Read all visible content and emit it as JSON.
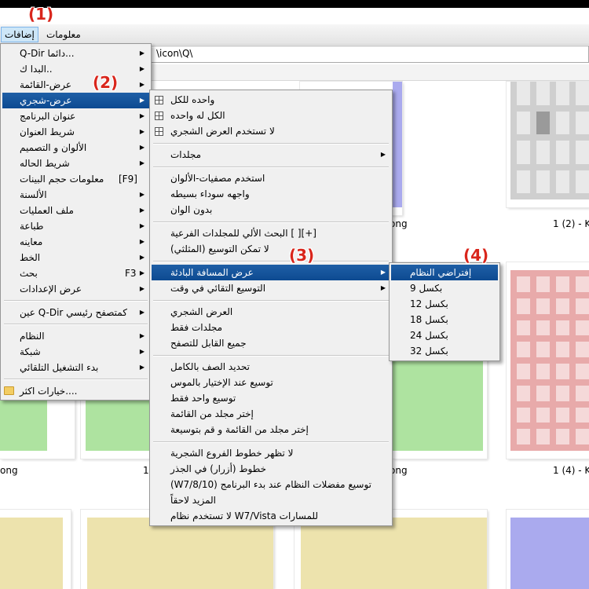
{
  "menubar": {
    "items": [
      "معلومات",
      "إضافات"
    ]
  },
  "address": {
    "path": "\\icon\\Q\\"
  },
  "captions": {
    "c1": "1 (2) - Ko",
    "c2": "ong",
    "c3": "ong",
    "c4": "ong",
    "c5": "1",
    "c6": "1 (4) - Ko"
  },
  "menu_main": {
    "items": [
      {
        "label": "Q-Dir دائما...",
        "sub": "▶"
      },
      {
        "label": "البدا ك..",
        "sub": "▶"
      },
      {
        "label": "عرض-القائمة",
        "sub": "▶"
      },
      {
        "label": "عرض-شجري",
        "sub": "▶"
      },
      {
        "label": "عنوان البرنامج",
        "sub": "▶"
      },
      {
        "label": "شريط العنوان",
        "sub": "▶"
      },
      {
        "label": "الألوان و التصميم",
        "sub": "▶"
      },
      {
        "label": "شريط الحاله",
        "sub": "▶"
      },
      {
        "label": "معلومات حجم البينات",
        "shortcut": "[F9]"
      },
      {
        "label": "الألسنة",
        "sub": "▶"
      },
      {
        "label": "ملف العمليات",
        "sub": "▶"
      },
      {
        "label": "طباعة",
        "sub": "▶"
      },
      {
        "label": "معاينه",
        "sub": "▶"
      },
      {
        "label": "الخط",
        "sub": "▶"
      },
      {
        "label": "بحث",
        "shortcut": "F3",
        "sub": "▶"
      },
      {
        "label": "عرض الإعدادات",
        "sub": "▶"
      },
      {
        "label": "عين Q-Dir كمتصفح رئيسي",
        "sub": "▶"
      },
      {
        "label": "النظام",
        "sub": "▶"
      },
      {
        "label": "شبكة",
        "sub": "▶"
      },
      {
        "label": "بدء التشغيل التلقائي",
        "sub": "▶"
      },
      {
        "label": "خيارات اكثر....",
        "icon": "folder-icon"
      }
    ]
  },
  "menu_tree": {
    "items": [
      {
        "label": "واحده للكل",
        "icon": "grid-icon"
      },
      {
        "label": "الكل له واحده",
        "icon": "grid-icon"
      },
      {
        "label": "لا تستخدم العرض الشجري",
        "icon": "grid-icon"
      },
      {
        "label": "مجلدات",
        "sub": "▶"
      },
      {
        "label": "استخدم مصفيات-الألوان"
      },
      {
        "label": "واجهه سوداء بسيطه"
      },
      {
        "label": "بدون الوان"
      },
      {
        "label": "البحث الألي للمجلدات الفرعية [ ][+]"
      },
      {
        "label": "لا تمكن التوسيع (المثلثي)"
      },
      {
        "label": "عرض المسافة البادئة",
        "sub": "▶"
      },
      {
        "label": "التوسيع التقائي في وقت",
        "sub": "▶"
      },
      {
        "label": "العرض الشجري"
      },
      {
        "label": "مجلدات فقط"
      },
      {
        "label": "جميع القابل للتصفح"
      },
      {
        "label": "تحديد الصف بالكامل"
      },
      {
        "label": "توسيع عند الإختيار بالموس"
      },
      {
        "label": "توسيع واحد فقط"
      },
      {
        "label": "إختر مجلد من القائمة"
      },
      {
        "label": "إختر مجلد من القائمة و قم بتوسيعة"
      },
      {
        "label": "لا تظهر خطوط الفروع الشجرية"
      },
      {
        "label": "خطوط (أزرار) في الجذر"
      },
      {
        "label": "(W7/8/10) توسيع مفضلات النظام عند بدء البرنامج"
      },
      {
        "label": "المزيد لاحقاً"
      },
      {
        "label": "لا تستخدم نظام W7/Vista للمسارات"
      }
    ]
  },
  "menu_indent": {
    "items": [
      {
        "label": "إفتراضي النظام"
      },
      {
        "label": "بكسل 9"
      },
      {
        "label": "بكسل 12"
      },
      {
        "label": "بكسل 18"
      },
      {
        "label": "بكسل 24"
      },
      {
        "label": "بكسل 32"
      }
    ]
  },
  "callouts": [
    "(1)",
    "(2)",
    "(3)",
    "(4)"
  ],
  "colors": {
    "highlight": "#0d4a91",
    "callout": "#d9261c",
    "tile_blue": "#aaaaee",
    "tile_gray": "#cfcfcf",
    "tile_red": "#e8aaaa",
    "tile_green": "#aee3a0",
    "tile_yellow": "#ede3ad"
  }
}
